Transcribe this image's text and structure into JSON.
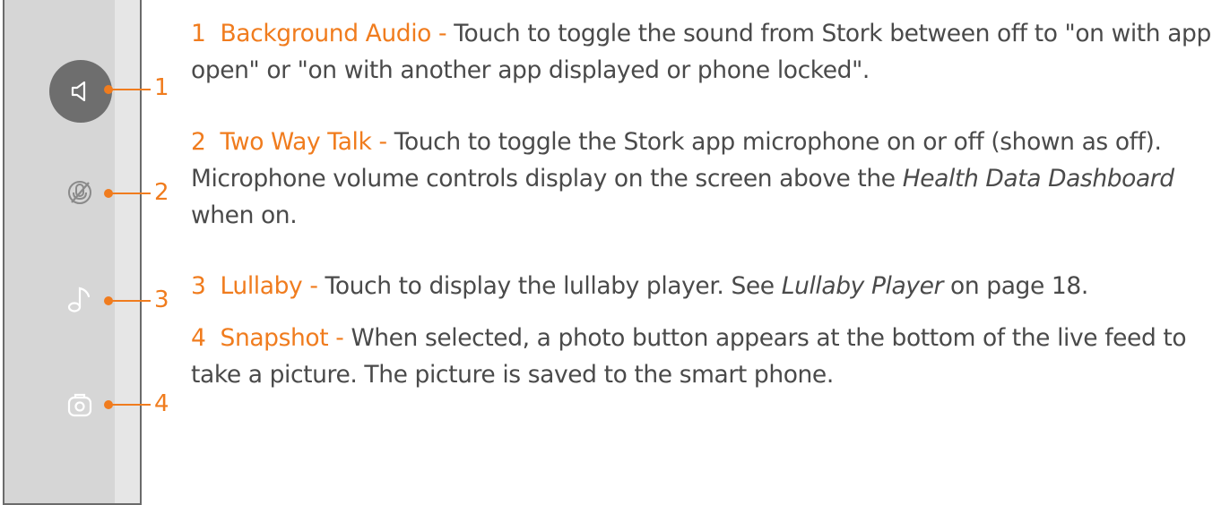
{
  "callouts": [
    "1",
    "2",
    "3",
    "4"
  ],
  "icons": [
    "speaker-icon",
    "mic-off-icon",
    "music-note-icon",
    "camera-icon"
  ],
  "items": [
    {
      "number": "1",
      "title": "Background Audio",
      "sep": "-",
      "body": "Touch to toggle the sound from Stork between off to \"on with app open\" or \"on with another app displayed or phone locked\"."
    },
    {
      "number": "2",
      "title": "Two Way Talk",
      "sep": "-",
      "body_a": "Touch to toggle the Stork app microphone on or off (shown as off). Microphone volume controls display on the screen above the ",
      "body_ref": "Health Data Dashboard",
      "body_b": " when on."
    },
    {
      "number": "3",
      "title": "Lullaby",
      "sep": "-",
      "body_a": "Touch to display the lullaby player. See ",
      "body_ref": "Lullaby Player",
      "body_b": " on page 18."
    },
    {
      "number": "4",
      "title": "Snapshot",
      "sep": "-",
      "body": "When selected, a photo button appears at the bottom of the live feed to take a picture. The picture is saved to the smart phone."
    }
  ],
  "colors": {
    "accent": "#f07c1e",
    "text": "#4a4a4a",
    "strip": "#d6d6d6",
    "active_button": "#6e6e6e"
  }
}
